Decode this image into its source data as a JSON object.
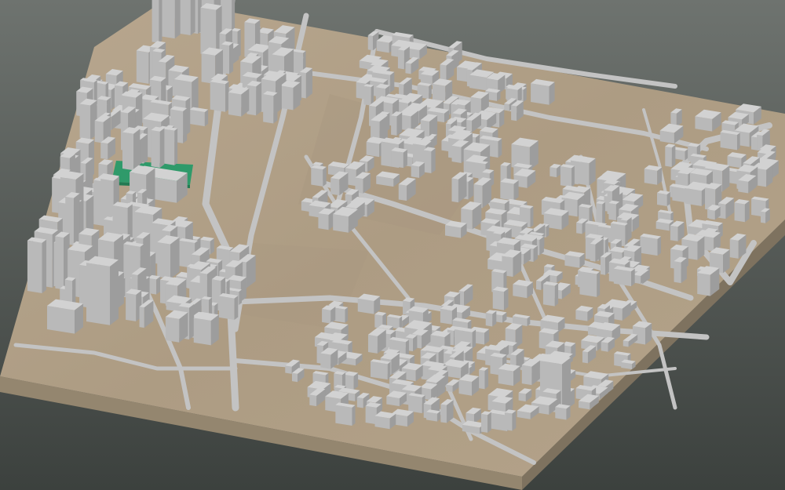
{
  "scene": {
    "kind": "3d-city-block-model",
    "view": "oblique-aerial",
    "labels": []
  },
  "colors": {
    "background_top": "#6e736f",
    "background_bottom": "#3c413e",
    "terrain": "#b3a28a",
    "terrain_shade": "#a89780",
    "base_side_front": "#94866f",
    "base_side_right": "#7e725f",
    "building_top": "#d2d2d2",
    "building_left": "#b9b9b9",
    "building_right": "#9d9d9d",
    "road": "#c3c3c3",
    "park": "#2f9a6a"
  },
  "icons": [
    "building-block-icon",
    "road-icon",
    "park-icon"
  ]
}
